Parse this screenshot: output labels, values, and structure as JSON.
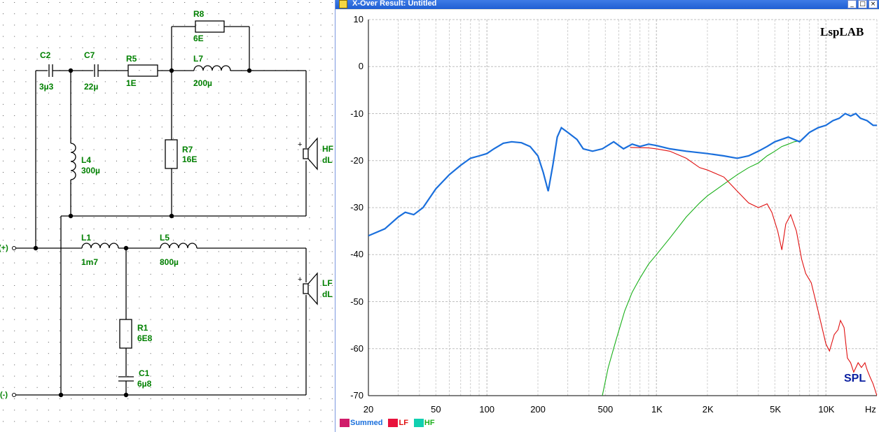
{
  "schematic": {
    "components": [
      {
        "ref": "C2",
        "value": "3µ3"
      },
      {
        "ref": "C7",
        "value": "22µ"
      },
      {
        "ref": "R5",
        "value": "1E"
      },
      {
        "ref": "R8",
        "value": "6E"
      },
      {
        "ref": "L7",
        "value": "200µ"
      },
      {
        "ref": "L4",
        "value": "300µ"
      },
      {
        "ref": "R7",
        "value": "16E"
      },
      {
        "ref": "L1",
        "value": "1m7"
      },
      {
        "ref": "L5",
        "value": "800µ"
      },
      {
        "ref": "R1",
        "value": "6E8"
      },
      {
        "ref": "C1",
        "value": "6µ8"
      }
    ],
    "drivers": [
      {
        "name": "HF",
        "sub": "dL"
      },
      {
        "name": "LF",
        "sub": "dL"
      }
    ],
    "terminals": [
      "(+)",
      "(-)"
    ]
  },
  "window": {
    "title": "X-Over Result: Untitled",
    "buttons": [
      "_",
      "□",
      "×"
    ]
  },
  "chart_data": {
    "type": "line",
    "title": "",
    "brand": "LspLAB",
    "quantity_label": "SPL",
    "xlabel": "Hz",
    "ylabel": "",
    "xscale": "log",
    "xlim": [
      20,
      20000
    ],
    "ylim": [
      -70,
      10
    ],
    "grid": true,
    "legend_position": "bottom-left",
    "y_ticks": [
      10,
      0,
      -10,
      -20,
      -30,
      -40,
      -50,
      -60,
      -70
    ],
    "x_ticks": [
      {
        "value": 20,
        "label": "20"
      },
      {
        "value": 50,
        "label": "50"
      },
      {
        "value": 100,
        "label": "100"
      },
      {
        "value": 200,
        "label": "200"
      },
      {
        "value": 500,
        "label": "500"
      },
      {
        "value": 1000,
        "label": "1K"
      },
      {
        "value": 2000,
        "label": "2K"
      },
      {
        "value": 5000,
        "label": "5K"
      },
      {
        "value": 10000,
        "label": "10K"
      }
    ],
    "series": [
      {
        "name": "Summed",
        "color": "#1a6fdc",
        "points": [
          [
            20,
            -36
          ],
          [
            25,
            -34.5
          ],
          [
            30,
            -32
          ],
          [
            33,
            -31
          ],
          [
            37,
            -31.5
          ],
          [
            42,
            -30
          ],
          [
            50,
            -26
          ],
          [
            60,
            -23
          ],
          [
            70,
            -21
          ],
          [
            80,
            -19.5
          ],
          [
            90,
            -19
          ],
          [
            100,
            -18.5
          ],
          [
            110,
            -17.5
          ],
          [
            125,
            -16.3
          ],
          [
            140,
            -16
          ],
          [
            160,
            -16.2
          ],
          [
            180,
            -17
          ],
          [
            200,
            -19
          ],
          [
            215,
            -22.5
          ],
          [
            230,
            -26.5
          ],
          [
            245,
            -21
          ],
          [
            260,
            -15
          ],
          [
            275,
            -13
          ],
          [
            300,
            -14
          ],
          [
            340,
            -15.5
          ],
          [
            370,
            -17.5
          ],
          [
            420,
            -18
          ],
          [
            480,
            -17.5
          ],
          [
            560,
            -16
          ],
          [
            640,
            -17.5
          ],
          [
            720,
            -16.5
          ],
          [
            800,
            -17
          ],
          [
            900,
            -16.5
          ],
          [
            1000,
            -16.8
          ],
          [
            1200,
            -17.5
          ],
          [
            1500,
            -18
          ],
          [
            2000,
            -18.5
          ],
          [
            2500,
            -19
          ],
          [
            3000,
            -19.5
          ],
          [
            3500,
            -19
          ],
          [
            4000,
            -18
          ],
          [
            4500,
            -17
          ],
          [
            5000,
            -16
          ],
          [
            6000,
            -15
          ],
          [
            7000,
            -16
          ],
          [
            8000,
            -14
          ],
          [
            9000,
            -13
          ],
          [
            10000,
            -12.5
          ],
          [
            11000,
            -11.5
          ],
          [
            12000,
            -11
          ],
          [
            13000,
            -10
          ],
          [
            14000,
            -10.5
          ],
          [
            15000,
            -10
          ],
          [
            16000,
            -11
          ],
          [
            17500,
            -11.5
          ],
          [
            19000,
            -12.5
          ],
          [
            20000,
            -12.5
          ]
        ]
      },
      {
        "name": "LF",
        "color": "#e01010",
        "points": [
          [
            700,
            -17.2
          ],
          [
            900,
            -17.3
          ],
          [
            1000,
            -17.5
          ],
          [
            1200,
            -18
          ],
          [
            1500,
            -19.5
          ],
          [
            1800,
            -21.5
          ],
          [
            2000,
            -22
          ],
          [
            2500,
            -23.5
          ],
          [
            3000,
            -26.5
          ],
          [
            3500,
            -29
          ],
          [
            4000,
            -30
          ],
          [
            4500,
            -29.2
          ],
          [
            4800,
            -31
          ],
          [
            5200,
            -35
          ],
          [
            5500,
            -39
          ],
          [
            5800,
            -33.5
          ],
          [
            6200,
            -31.5
          ],
          [
            6700,
            -35
          ],
          [
            7200,
            -41
          ],
          [
            7600,
            -44
          ],
          [
            8200,
            -46
          ],
          [
            9000,
            -52
          ],
          [
            10000,
            -59
          ],
          [
            10500,
            -60.5
          ],
          [
            11200,
            -57
          ],
          [
            11800,
            -56
          ],
          [
            12200,
            -54
          ],
          [
            12800,
            -55.5
          ],
          [
            13400,
            -62
          ],
          [
            14000,
            -63
          ],
          [
            14600,
            -65
          ],
          [
            15500,
            -63
          ],
          [
            16200,
            -64
          ],
          [
            17000,
            -63
          ],
          [
            17500,
            -64.5
          ],
          [
            18200,
            -66
          ],
          [
            19000,
            -67.5
          ],
          [
            20000,
            -70
          ]
        ]
      },
      {
        "name": "HF",
        "color": "#1ab01a",
        "points": [
          [
            480,
            -70
          ],
          [
            520,
            -64
          ],
          [
            580,
            -58
          ],
          [
            650,
            -52
          ],
          [
            720,
            -48
          ],
          [
            800,
            -45
          ],
          [
            900,
            -42
          ],
          [
            1000,
            -40
          ],
          [
            1200,
            -36.5
          ],
          [
            1500,
            -32
          ],
          [
            1800,
            -29
          ],
          [
            2000,
            -27.5
          ],
          [
            2500,
            -25
          ],
          [
            3000,
            -23
          ],
          [
            3500,
            -21.5
          ],
          [
            4000,
            -20.5
          ],
          [
            4500,
            -19
          ],
          [
            5000,
            -18
          ],
          [
            5500,
            -17
          ],
          [
            6000,
            -16.5
          ],
          [
            6500,
            -16
          ],
          [
            7000,
            -15.8
          ]
        ]
      }
    ]
  },
  "legend": [
    {
      "label": "Summed",
      "swatch": "#d01c6a",
      "text_color": "#1a6fdc"
    },
    {
      "label": "LF",
      "swatch": "#e8123c",
      "text_color": "#e01010"
    },
    {
      "label": "HF",
      "swatch": "#10d0b0",
      "text_color": "#1ab01a"
    }
  ]
}
